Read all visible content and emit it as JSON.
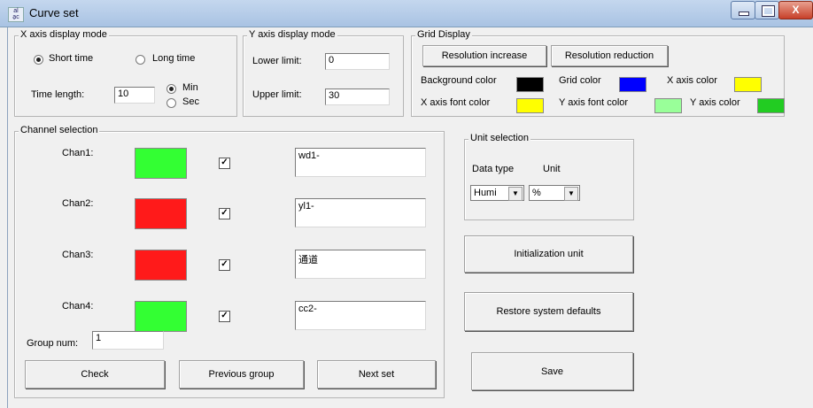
{
  "window": {
    "title": "Curve set",
    "icon": "chart-app-icon",
    "close_label": "X"
  },
  "x_axis": {
    "legend": "X axis display mode",
    "short_time_label": "Short time",
    "long_time_label": "Long time",
    "time_length_label": "Time length:",
    "time_length_value": "10",
    "min_label": "Min",
    "sec_label": "Sec"
  },
  "y_axis": {
    "legend": "Y axis display mode",
    "lower_label": "Lower limit:",
    "lower_value": "0",
    "upper_label": "Upper limit:",
    "upper_value": "30"
  },
  "grid": {
    "legend": "Grid Display",
    "resolution_increase": "Resolution increase",
    "resolution_reduction": "Resolution reduction",
    "background_color_label": "Background color",
    "background_color": "#000000",
    "grid_color_label": "Grid color",
    "grid_color": "#0000ff",
    "x_axis_color_label": "X axis color",
    "x_axis_color": "#ffff00",
    "x_font_color_label": "X axis font color",
    "x_font_color": "#ffff00",
    "y_font_color_label": "Y axis font color",
    "y_font_color": "#99ff99",
    "y_axis_color_label": "Y axis color",
    "y_axis_color": "#22cc22"
  },
  "channels": {
    "legend": "Channel selection",
    "items": [
      {
        "label": "Chan1:",
        "color": "#33ff33",
        "checked": "☑",
        "name": "wd1-"
      },
      {
        "label": "Chan2:",
        "color": "#ff1a1a",
        "checked": "☑",
        "name": "yl1-"
      },
      {
        "label": "Chan3:",
        "color": "#ff1a1a",
        "checked": "☑",
        "name": "通道"
      },
      {
        "label": "Chan4:",
        "color": "#33ff33",
        "checked": "☑",
        "name": "cc2-"
      }
    ],
    "group_num_label": "Group num:",
    "group_num_value": "1",
    "check_label": "Check",
    "previous_group_label": "Previous group",
    "next_set_label": "Next set"
  },
  "unit": {
    "legend": "Unit selection",
    "data_type_label": "Data type",
    "unit_label": "Unit",
    "data_type_value": "Humi",
    "unit_value": "%"
  },
  "actions": {
    "init_unit": "Initialization unit",
    "restore_defaults": "Restore system defaults",
    "save": "Save"
  }
}
